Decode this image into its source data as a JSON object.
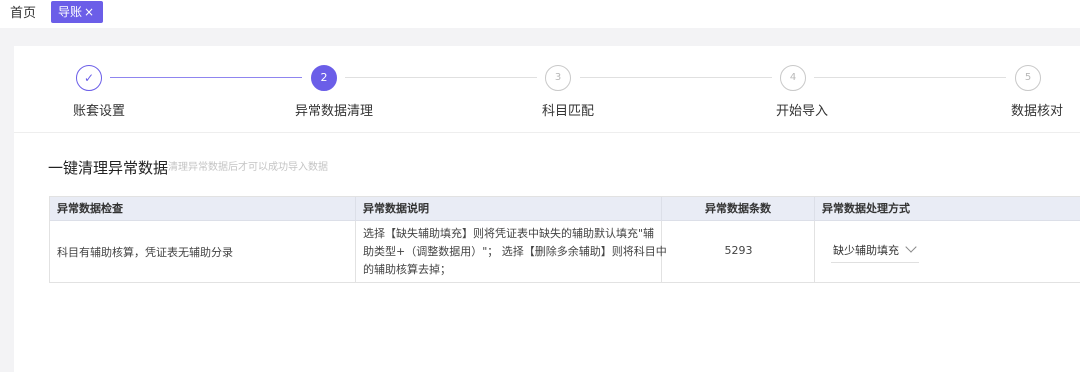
{
  "tabs": {
    "home_label": "首页",
    "active_label": "导账",
    "close_glyph": "×"
  },
  "steps": [
    {
      "index": "✓",
      "label": "账套设置",
      "state": "done"
    },
    {
      "index": "2",
      "label": "异常数据清理",
      "state": "active"
    },
    {
      "index": "3",
      "label": "科目匹配",
      "state": "pending"
    },
    {
      "index": "4",
      "label": "开始导入",
      "state": "pending"
    },
    {
      "index": "5",
      "label": "数据核对",
      "state": "pending"
    }
  ],
  "section": {
    "title": "一键清理异常数据",
    "hint": "清理异常数据后才可以成功导入数据"
  },
  "table": {
    "headers": [
      "异常数据检查",
      "异常数据说明",
      "异常数据条数",
      "异常数据处理方式"
    ],
    "rows": [
      {
        "check": "科目有辅助核算，凭证表无辅助分录",
        "description_lines": [
          "选择【缺失辅助填充】则将凭证表中缺失的辅助默认填充\"辅",
          "助类型+（调整数据用）\"；  选择【删除多余辅助】则将科目中",
          "的辅助核算去掉；"
        ],
        "count": "5293",
        "method": "缺少辅助填充"
      }
    ]
  },
  "colors": {
    "accent": "#6b5ee8",
    "header_bg": "#e9ecf5",
    "page_bg": "#f3f3f5"
  },
  "icons": {
    "check": "check-icon",
    "close": "close-icon",
    "chevron": "chevron-down-icon"
  }
}
